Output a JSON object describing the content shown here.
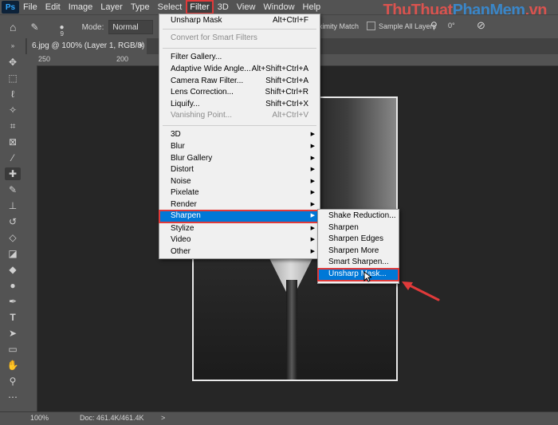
{
  "menubar": {
    "logo": "Ps",
    "items": [
      "File",
      "Edit",
      "Image",
      "Layer",
      "Type",
      "Select",
      "Filter",
      "3D",
      "View",
      "Window",
      "Help"
    ],
    "active": "Filter"
  },
  "watermark": {
    "part1": "ThuThuat",
    "part2": "PhanMem",
    "part3": ".vn"
  },
  "options": {
    "brush_size": "9",
    "mode_label": "Mode:",
    "mode_value": "Normal",
    "proximity": "ximity Match",
    "sample_all_layers": "Sample All Layers",
    "angle": "0°"
  },
  "document_tab": {
    "title": "6.jpg @ 100% (Layer 1, RGB/8) *",
    "close": "×"
  },
  "ruler_h": [
    "250",
    "200",
    "1"
  ],
  "filter_menu": {
    "last_filter": {
      "label": "Unsharp Mask",
      "shortcut": "Alt+Ctrl+F"
    },
    "convert_smart": "Convert for Smart Filters",
    "group1": [
      {
        "label": "Filter Gallery...",
        "shortcut": "",
        "disabled": false
      },
      {
        "label": "Adaptive Wide Angle...",
        "shortcut": "Alt+Shift+Ctrl+A",
        "disabled": false
      },
      {
        "label": "Camera Raw Filter...",
        "shortcut": "Shift+Ctrl+A",
        "disabled": false
      },
      {
        "label": "Lens Correction...",
        "shortcut": "Shift+Ctrl+R",
        "disabled": false
      },
      {
        "label": "Liquify...",
        "shortcut": "Shift+Ctrl+X",
        "disabled": false
      },
      {
        "label": "Vanishing Point...",
        "shortcut": "Alt+Ctrl+V",
        "disabled": true
      }
    ],
    "submenus": [
      "3D",
      "Blur",
      "Blur Gallery",
      "Distort",
      "Noise",
      "Pixelate",
      "Render",
      "Sharpen",
      "Stylize",
      "Video",
      "Other"
    ],
    "highlighted": "Sharpen"
  },
  "sharpen_menu": {
    "items": [
      "Shake Reduction...",
      "Sharpen",
      "Sharpen Edges",
      "Sharpen More",
      "Smart Sharpen...",
      "Unsharp Mask..."
    ],
    "highlighted": "Unsharp Mask..."
  },
  "status": {
    "zoom": "100%",
    "doc": "Doc: 461.4K/461.4K",
    "arrow": ">"
  }
}
